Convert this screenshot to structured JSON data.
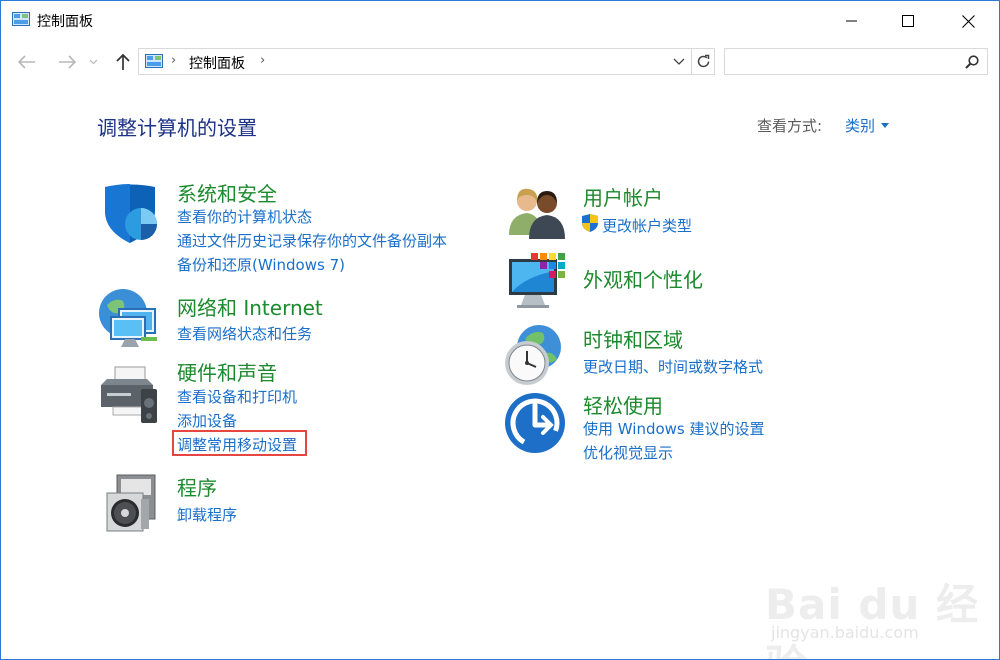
{
  "window": {
    "title": "控制面板"
  },
  "nav": {
    "address_path": "控制面板",
    "search_placeholder": ""
  },
  "content": {
    "page_title": "调整计算机的设置",
    "view_by_label": "查看方式:",
    "view_by_value": "类别"
  },
  "categories": [
    {
      "title": "系统和安全",
      "icon": "shield-icon",
      "links": [
        "查看你的计算机状态",
        "通过文件历史记录保存你的文件备份副本",
        "备份和还原(Windows 7)"
      ]
    },
    {
      "title": "网络和 Internet",
      "icon": "network-globe-icon",
      "links": [
        "查看网络状态和任务"
      ]
    },
    {
      "title": "硬件和声音",
      "icon": "printer-icon",
      "links": [
        "查看设备和打印机",
        "添加设备",
        "调整常用移动设置"
      ]
    },
    {
      "title": "程序",
      "icon": "programs-disc-icon",
      "links": [
        "卸载程序"
      ]
    },
    {
      "title": "用户帐户",
      "icon": "users-icon",
      "links": [
        "更改帐户类型"
      ]
    },
    {
      "title": "外观和个性化",
      "icon": "monitor-colors-icon",
      "links": []
    },
    {
      "title": "时钟和区域",
      "icon": "clock-globe-icon",
      "links": [
        "更改日期、时间或数字格式"
      ]
    },
    {
      "title": "轻松使用",
      "icon": "ease-of-access-icon",
      "links": [
        "使用 Windows 建议的设置",
        "优化视觉显示"
      ]
    }
  ],
  "highlight_color": "#e6463f",
  "accent_link_color": "#1a6fc9",
  "category_title_color": "#1c8a2d",
  "watermark": {
    "main": "Bai du 经验",
    "sub": "jingyan.baidu.com"
  }
}
